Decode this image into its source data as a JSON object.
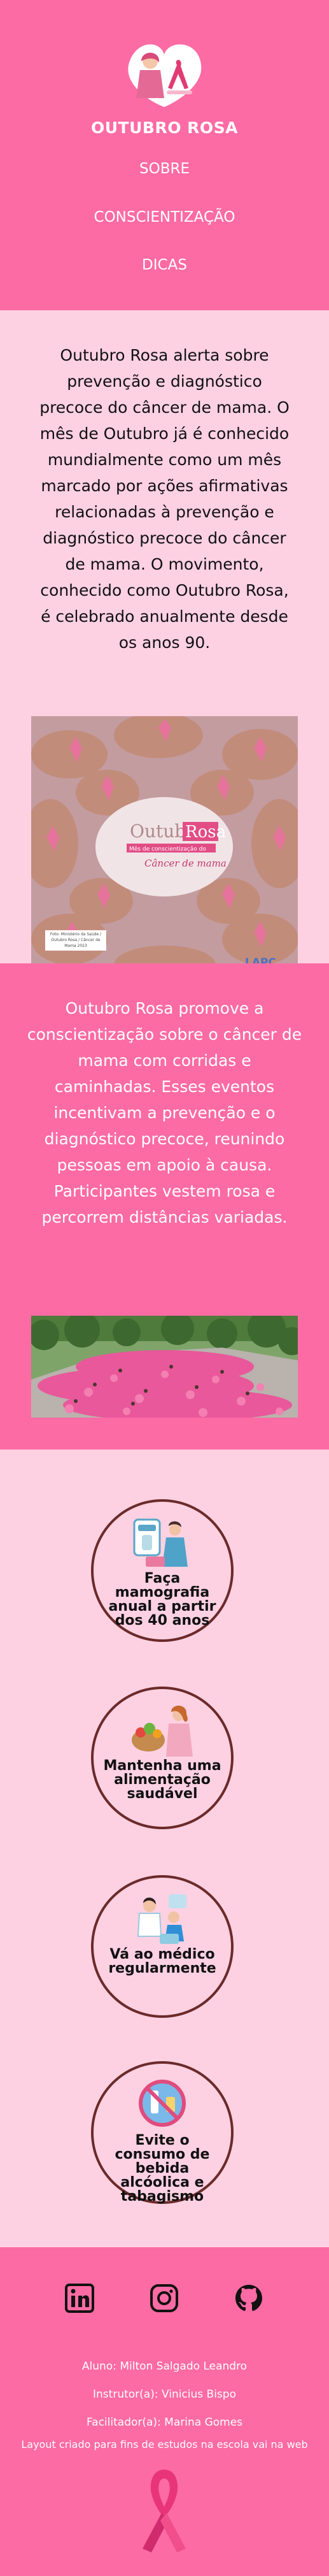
{
  "header": {
    "title": "OUTUBRO ROSA",
    "nav": [
      "SOBRE",
      "CONSCIENTIZAÇÃO",
      "DICAS"
    ]
  },
  "about": {
    "text": "Outubro Rosa alerta sobre prevenção e diagnóstico precoce do câncer de mama. O mês de Outubro já é conhecido mundialmente como um mês marcado por ações afirmativas relacionadas à prevenção e diagnóstico precoce do câncer de mama. O movimento, conhecido como Outubro Rosa, é celebrado anualmente desde os anos 90.",
    "image": {
      "title_part1": "Outubro",
      "title_part2": "Rosa",
      "subtitle": "Mês de conscientização do",
      "script": "Câncer de mama",
      "caption": "Foto: Ministério da Saúde / Outubro Rosa / Câncer de Mama 2023",
      "brand": "LAPC"
    }
  },
  "race": {
    "text": "Outubro Rosa promove a conscientização sobre o câncer de mama com corridas e caminhadas. Esses eventos incentivam a prevenção e o diagnóstico precoce, reunindo pessoas em apoio à causa. Participantes vestem rosa e percorrem distâncias variadas."
  },
  "tips": [
    {
      "label": "Faça mamografia anual a partir dos 40 anos",
      "icon": "mammography-icon"
    },
    {
      "label": "Mantenha uma alimentação saudável",
      "icon": "healthy-food-icon"
    },
    {
      "label": "Vá ao médico regularmente",
      "icon": "doctor-visit-icon"
    },
    {
      "label": "Evite o consumo de bebida alcóolica e tabagismo",
      "icon": "no-smoking-drinking-icon"
    }
  ],
  "footer": {
    "social": [
      "linkedin-icon",
      "instagram-icon",
      "github-icon"
    ],
    "student": "Aluno: Milton Salgado Leandro",
    "instructor": "Instrutor(a): Vinicius Bispo",
    "facilitator": "Facilitador(a): Marina Gomes",
    "note": "Layout criado para fins de estudos na escola vai na web"
  },
  "colors": {
    "primary_pink": "#fd6ba4",
    "light_pink": "#fdd1e1",
    "circle_border": "#6b2b2b"
  }
}
